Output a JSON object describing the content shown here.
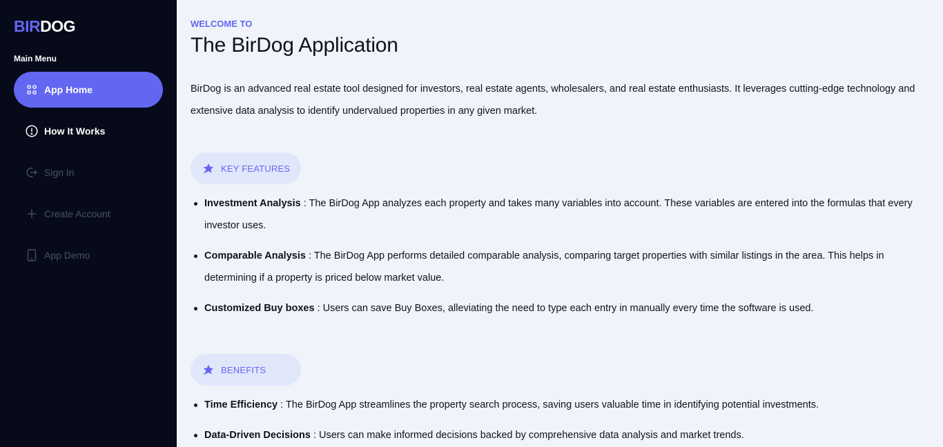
{
  "brand": {
    "part1": "BIR",
    "part2": "DOG",
    "accent": "#6366f1"
  },
  "sidebar": {
    "menu_label": "Main Menu",
    "items": [
      {
        "label": "App Home",
        "icon": "grid-dots-icon",
        "state": "active"
      },
      {
        "label": "How It Works",
        "icon": "info-circle-icon",
        "state": "normal"
      },
      {
        "label": "Sign In",
        "icon": "sign-in-icon",
        "state": "muted"
      },
      {
        "label": "Create Account",
        "icon": "plus-icon",
        "state": "muted"
      },
      {
        "label": "App Demo",
        "icon": "phone-icon",
        "state": "muted"
      }
    ]
  },
  "main": {
    "welcome": "WELCOME TO",
    "title": "The BirDog Application",
    "intro": "BirDog is an advanced real estate tool designed for investors, real estate agents, wholesalers, and real estate enthusiasts. It leverages cutting-edge technology and extensive data analysis to identify undervalued properties in any given market.",
    "features": {
      "label": "KEY FEATURES",
      "icon": "star-icon",
      "items": [
        {
          "term": "Investment Analysis",
          "text": " : The BirDog App analyzes each property and takes many variables into account. These variables are entered into the formulas that every investor uses."
        },
        {
          "term": "Comparable Analysis",
          "text": " : The BirDog App performs detailed comparable analysis, comparing target properties with similar listings in the area. This helps in determining if a property is priced below market value."
        },
        {
          "term": "Customized Buy boxes",
          "text": " : Users can save Buy Boxes, alleviating the need to type each entry in manually every time the software is used."
        }
      ]
    },
    "benefits": {
      "label": "BENEFITS",
      "icon": "star-icon",
      "items": [
        {
          "term": "Time Efficiency",
          "text": " : The BirDog App streamlines the property search process, saving users valuable time in identifying potential investments."
        },
        {
          "term": "Data-Driven Decisions",
          "text": " : Users can make informed decisions backed by comprehensive data analysis and market trends."
        }
      ]
    }
  }
}
